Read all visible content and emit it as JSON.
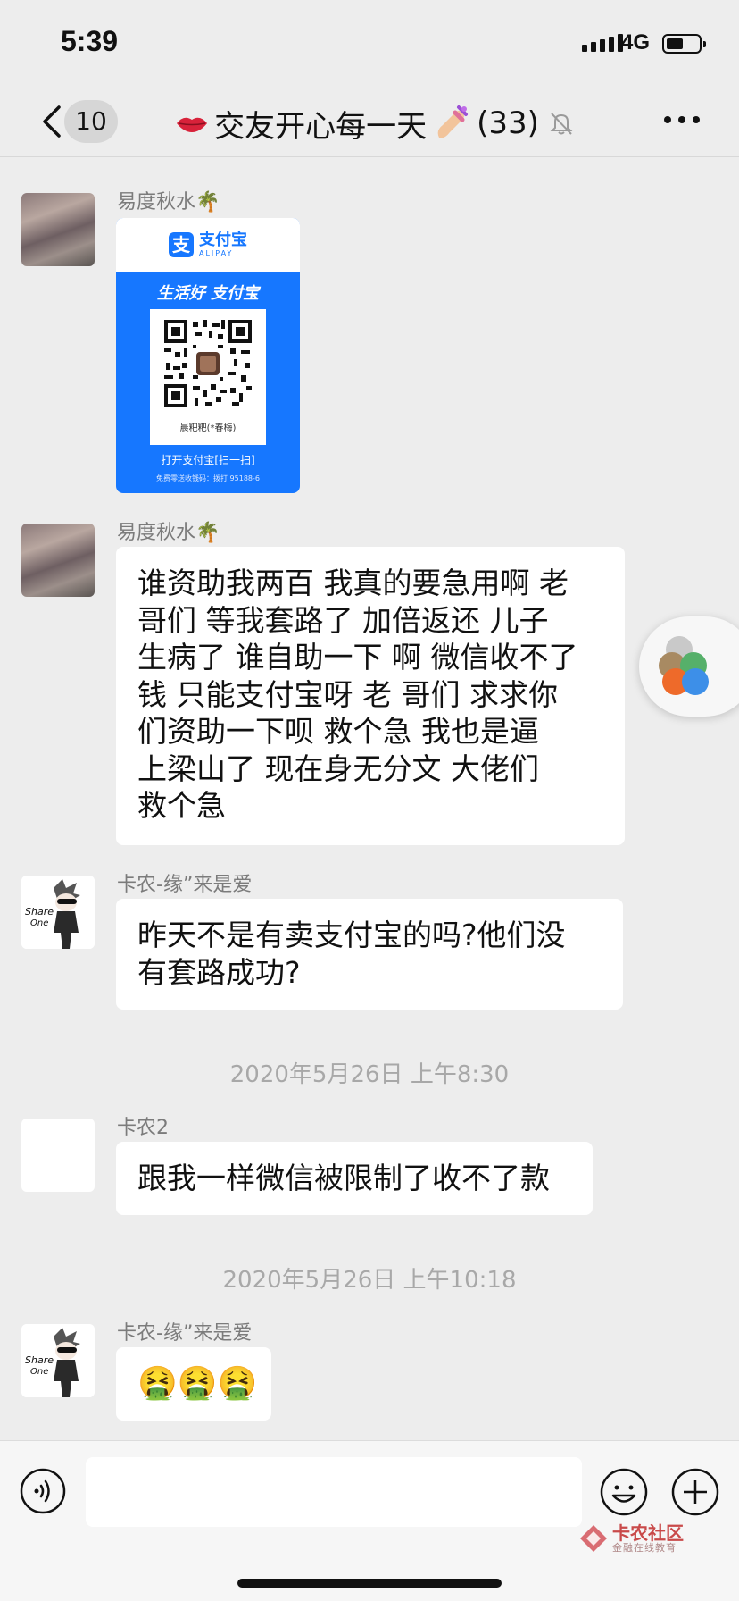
{
  "status_bar": {
    "time": "5:39",
    "network": "4G"
  },
  "nav": {
    "back_count": "10",
    "title": "交友开心每一天",
    "member_count": "(33)"
  },
  "messages": [
    {
      "sender": "易度秋水🌴",
      "type": "alipay_qr",
      "alipay": {
        "brand": "支付宝",
        "brand_en": "ALIPAY",
        "slogan": "生活好 支付宝",
        "payee": "晨粑粑(*春梅)",
        "open_text": "打开支付宝[扫一扫]",
        "hint": "免费零送收钱码：拨打 95188-6"
      }
    },
    {
      "sender": "易度秋水🌴",
      "lines": [
        "谁资助我两百  我真的要急用啊  老",
        "哥们 等我套路了 加倍返还   儿子",
        "生病了 谁自助一下 啊 微信收不了",
        "钱  只能支付宝呀  老 哥们 求求你",
        "们资助一下呗   救个急  我也是逼",
        "上梁山了  现在身无分文  大佬们",
        "救个急"
      ]
    },
    {
      "sender": "卡农-缘”来是爱",
      "lines": [
        "昨天不是有卖支付宝的吗?他们没",
        "有套路成功?"
      ]
    },
    {
      "timestamp": "2020年5月26日 上午8:30"
    },
    {
      "sender": "卡农2",
      "lines": [
        "跟我一样微信被限制了收不了款"
      ]
    },
    {
      "timestamp": "2020年5月26日 上午10:18"
    },
    {
      "sender": "卡农-缘”来是爱",
      "lines": [
        "🤮🤮🤮"
      ]
    }
  ],
  "input": {
    "value": ""
  },
  "watermark": {
    "title": "卡农社区",
    "subtitle": "金融在线教育"
  },
  "colors": {
    "alipay_blue": "#1677ff",
    "page_bg": "#ededed"
  }
}
